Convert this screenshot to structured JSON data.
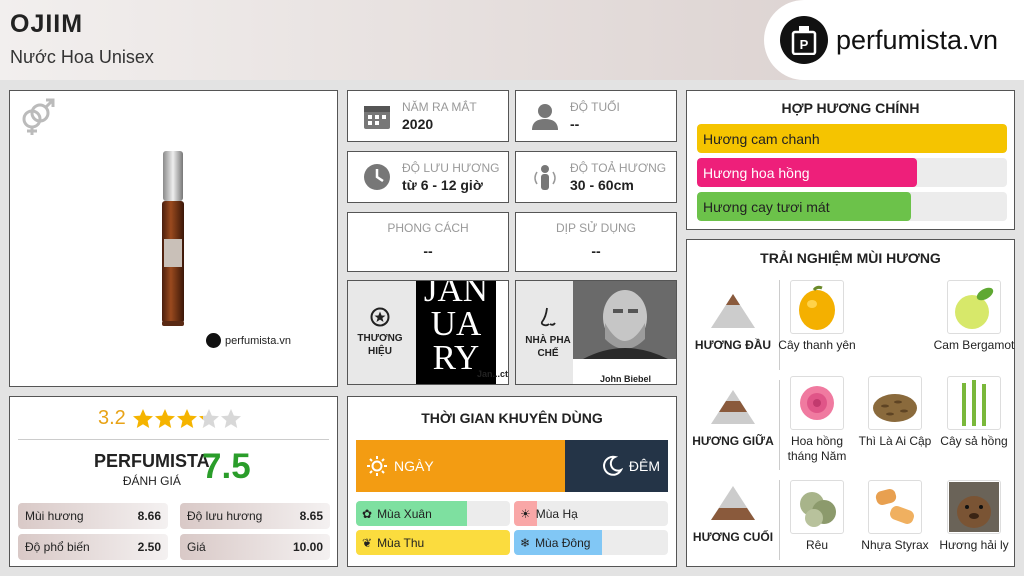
{
  "product": {
    "name": "OJIIM",
    "subtitle": "Nước Hoa Unisex"
  },
  "brand_logo": {
    "text": "perfumista.vn",
    "watermark": "perfumista.vn"
  },
  "info": {
    "release_year": {
      "label": "NĂM RA MẮT",
      "value": "2020"
    },
    "age": {
      "label": "ĐỘ TUỔI",
      "value": "--"
    },
    "longevity": {
      "label": "ĐỘ LƯU HƯƠNG",
      "value": "từ 6 - 12 giờ"
    },
    "sillage": {
      "label": "ĐỘ TOẢ HƯƠNG",
      "value": "30 - 60cm"
    },
    "style": {
      "label": "PHONG CÁCH",
      "value": "--"
    },
    "occasion": {
      "label": "DỊP SỬ DỤNG",
      "value": "--"
    }
  },
  "brand": {
    "label_line1": "THƯƠNG",
    "label_line2": "HIỆU",
    "logo_lines": [
      "JAN",
      "UA",
      "RY"
    ],
    "caption": "Jan...ct"
  },
  "perfumer": {
    "label_line1": "NHÀ PHA",
    "label_line2": "CHẾ",
    "name": "John Biebel"
  },
  "accords": {
    "title": "HỢP HƯƠNG CHÍNH",
    "items": [
      {
        "label": "Hương cam chanh",
        "percent": 100,
        "color": "#f5c400"
      },
      {
        "label": "Hương hoa hồng",
        "percent": 71,
        "color": "#ee1f7a"
      },
      {
        "label": "Hương cay tươi mát",
        "percent": 69,
        "color": "#6cc24a"
      }
    ]
  },
  "notes": {
    "title": "TRẢI NGHIỆM MÙI HƯƠNG",
    "top": {
      "label": "HƯƠNG ĐẦU",
      "items": [
        "Cây thanh yên",
        "Cam Bergamot"
      ]
    },
    "middle": {
      "label": "HƯƠNG GIỮA",
      "items": [
        "Hoa hồng tháng Năm",
        "Thì Là Ai Cập",
        "Cây sả hồng"
      ]
    },
    "base": {
      "label": "HƯƠNG CUỐI",
      "items": [
        "Rêu",
        "Nhựa Styrax",
        "Hương hải ly"
      ]
    }
  },
  "rating": {
    "stars_value": "3.2",
    "stars": 3.2,
    "brand": "PERFUMISTA",
    "brand_sub": "ĐÁNH GIÁ",
    "score": "7.5",
    "stats": [
      {
        "label": "Mùi hương",
        "value": "8.66"
      },
      {
        "label": "Độ lưu hương",
        "value": "8.65"
      },
      {
        "label": "Độ phổ biến",
        "value": "2.50"
      },
      {
        "label": "Giá",
        "value": "10.00"
      }
    ]
  },
  "time": {
    "title": "THỜI GIAN KHUYÊN DÙNG",
    "day": {
      "label": "NGÀY",
      "color": "#f39c12"
    },
    "night": {
      "label": "ĐÊM",
      "color": "#243447"
    },
    "seasons": [
      {
        "label": "Mùa Xuân",
        "percent": 72,
        "color": "#7ee0a0"
      },
      {
        "label": "Mùa Hạ",
        "percent": 15,
        "color": "#f9a7a7"
      },
      {
        "label": "Mùa Thu",
        "percent": 100,
        "color": "#fbdc3e"
      },
      {
        "label": "Mùa Đông",
        "percent": 57,
        "color": "#81c7f5"
      }
    ]
  }
}
